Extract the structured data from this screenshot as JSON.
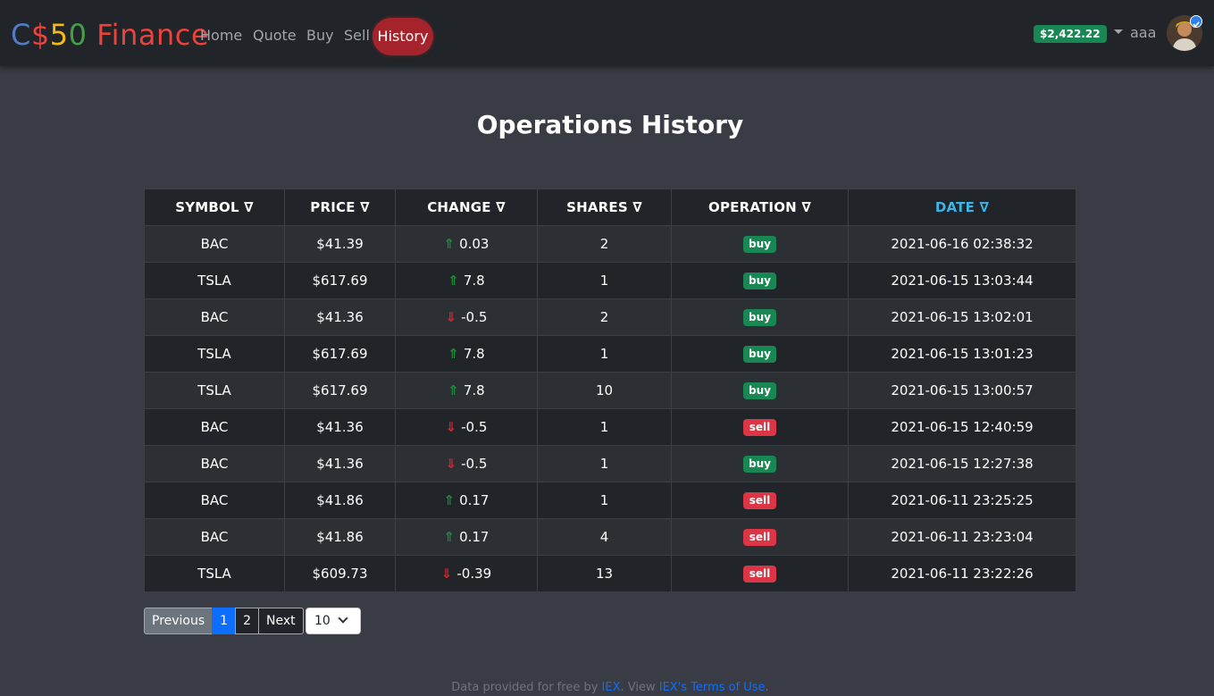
{
  "navbar": {
    "brand": {
      "p1": "C",
      "p2": "$",
      "p3": "5",
      "p4": "0",
      "p5": " Finance"
    },
    "links": [
      "Home",
      "Quote",
      "Buy",
      "Sell"
    ],
    "active_link": "History",
    "cash": "$2,422.22",
    "username": "aaa"
  },
  "page": {
    "title": "Operations History"
  },
  "table": {
    "headers": [
      "SYMBOL ∇",
      "PRICE ∇",
      "CHANGE ∇",
      "SHARES ∇",
      "OPERATION ∇",
      "DATE ∇"
    ],
    "rows": [
      {
        "symbol": "BAC",
        "price": "$41.39",
        "dir": "up",
        "arrow": "⇑",
        "change": "0.03",
        "shares": "2",
        "operation": "buy",
        "date": "2021-06-16 02:38:32"
      },
      {
        "symbol": "TSLA",
        "price": "$617.69",
        "dir": "up",
        "arrow": "⇑",
        "change": "7.8",
        "shares": "1",
        "operation": "buy",
        "date": "2021-06-15 13:03:44"
      },
      {
        "symbol": "BAC",
        "price": "$41.36",
        "dir": "down",
        "arrow": "⇓",
        "change": "-0.5",
        "shares": "2",
        "operation": "buy",
        "date": "2021-06-15 13:02:01"
      },
      {
        "symbol": "TSLA",
        "price": "$617.69",
        "dir": "up",
        "arrow": "⇑",
        "change": "7.8",
        "shares": "1",
        "operation": "buy",
        "date": "2021-06-15 13:01:23"
      },
      {
        "symbol": "TSLA",
        "price": "$617.69",
        "dir": "up",
        "arrow": "⇑",
        "change": "7.8",
        "shares": "10",
        "operation": "buy",
        "date": "2021-06-15 13:00:57"
      },
      {
        "symbol": "BAC",
        "price": "$41.36",
        "dir": "down",
        "arrow": "⇓",
        "change": "-0.5",
        "shares": "1",
        "operation": "sell",
        "date": "2021-06-15 12:40:59"
      },
      {
        "symbol": "BAC",
        "price": "$41.36",
        "dir": "down",
        "arrow": "⇓",
        "change": "-0.5",
        "shares": "1",
        "operation": "buy",
        "date": "2021-06-15 12:27:38"
      },
      {
        "symbol": "BAC",
        "price": "$41.86",
        "dir": "up",
        "arrow": "⇑",
        "change": "0.17",
        "shares": "1",
        "operation": "sell",
        "date": "2021-06-11 23:25:25"
      },
      {
        "symbol": "BAC",
        "price": "$41.86",
        "dir": "up",
        "arrow": "⇑",
        "change": "0.17",
        "shares": "4",
        "operation": "sell",
        "date": "2021-06-11 23:23:04"
      },
      {
        "symbol": "TSLA",
        "price": "$609.73",
        "dir": "down",
        "arrow": "⇓",
        "change": "-0.39",
        "shares": "13",
        "operation": "sell",
        "date": "2021-06-11 23:22:26"
      }
    ]
  },
  "pagination": {
    "previous": "Previous",
    "pages": [
      "1",
      "2"
    ],
    "active_page": "1",
    "next": "Next",
    "page_size": "10"
  },
  "footer": {
    "text1": "Data provided for free by ",
    "link1": "IEX",
    "text2": ". View ",
    "link2": "IEX's Terms of Use",
    "text3": "."
  },
  "colors": {
    "up": "#1e8c3a",
    "down": "#d9262e",
    "buy": "#198754",
    "sell": "#dc3545",
    "active_nav": "#a5242b",
    "sorted_header": "#3cb4e6"
  }
}
